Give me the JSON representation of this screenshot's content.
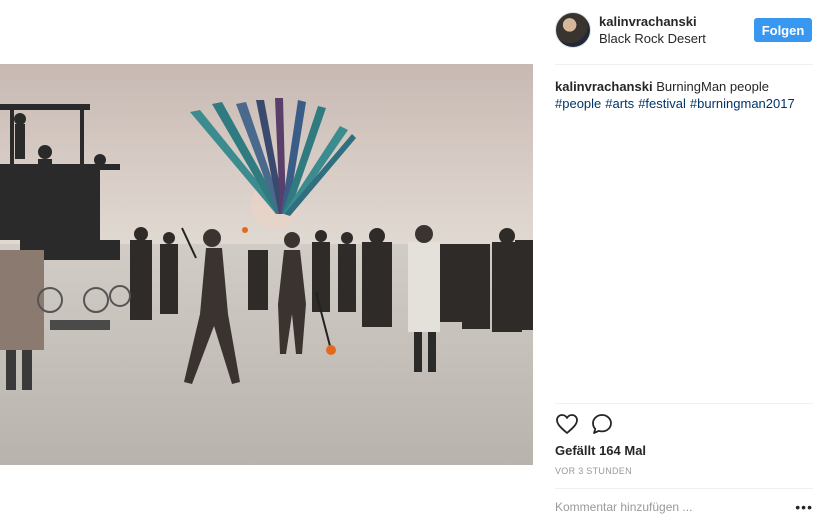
{
  "post": {
    "username": "kalinvrachanski",
    "location": "Black Rock Desert",
    "follow_label": "Folgen",
    "caption_user": "kalinvrachanski",
    "caption_text": "BurningMan people",
    "hashtags": [
      "#people",
      "#arts",
      "#festival",
      "#burningman2017"
    ],
    "likes_text": "Gefällt 164 Mal",
    "time_text": "VOR 3 STUNDEN",
    "comment_placeholder": "Kommentar hinzufügen ...",
    "more_label": "•••"
  },
  "icons": {
    "like": "heart-outline-icon",
    "comment": "speech-bubble-icon",
    "avatar": "user-avatar",
    "more": "ellipsis-icon"
  },
  "colors": {
    "accent": "#3897f0",
    "hashtag": "#003569",
    "text": "#262626",
    "muted": "#999999"
  }
}
